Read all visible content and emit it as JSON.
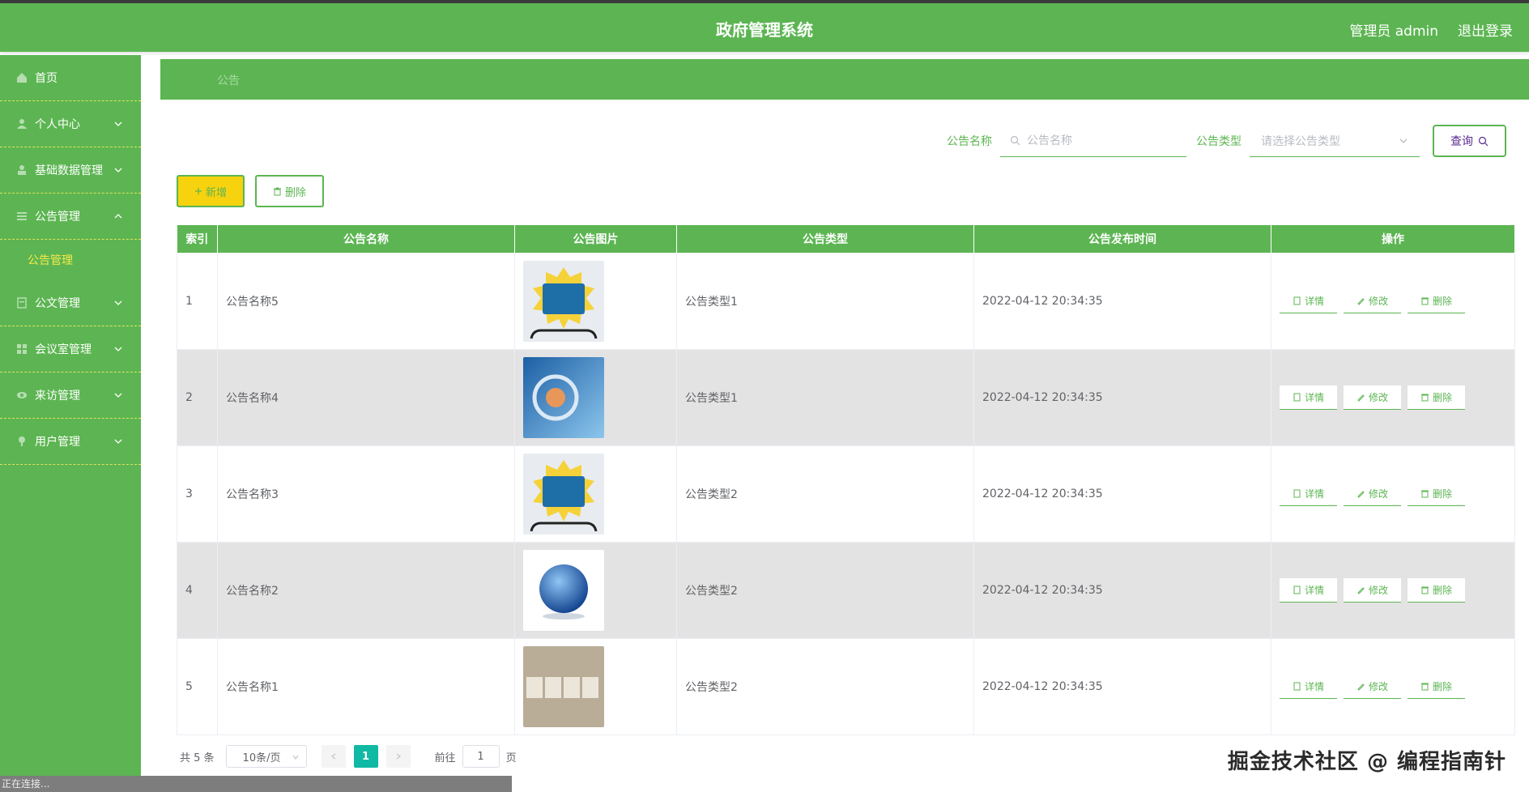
{
  "header": {
    "title": "政府管理系统",
    "user": "管理员 admin",
    "logout": "退出登录"
  },
  "sidebar": {
    "items": [
      {
        "label": "首页"
      },
      {
        "label": "个人中心"
      },
      {
        "label": "基础数据管理"
      },
      {
        "label": "公告管理"
      },
      {
        "label": "公文管理"
      },
      {
        "label": "会议室管理"
      },
      {
        "label": "来访管理"
      },
      {
        "label": "用户管理"
      }
    ],
    "sub_active": "公告管理"
  },
  "breadcrumb": "公告",
  "search": {
    "name_label": "公告名称",
    "name_placeholder": "公告名称",
    "type_label": "公告类型",
    "type_placeholder": "请选择公告类型",
    "query_label": "查询"
  },
  "actions": {
    "add": "新增",
    "delete": "删除"
  },
  "table": {
    "headers": [
      "索引",
      "公告名称",
      "公告图片",
      "公告类型",
      "公告发布时间",
      "操作"
    ],
    "rows": [
      {
        "index": "1",
        "name": "公告名称5",
        "image": "news-image-baodian",
        "type": "公告类型1",
        "time": "2022-04-12 20:34:35"
      },
      {
        "index": "2",
        "name": "公告名称4",
        "image": "news-image-blue",
        "type": "公告类型1",
        "time": "2022-04-12 20:34:35"
      },
      {
        "index": "3",
        "name": "公告名称3",
        "image": "news-image-baodian",
        "type": "公告类型2",
        "time": "2022-04-12 20:34:35"
      },
      {
        "index": "4",
        "name": "公告名称2",
        "image": "news-image-globe",
        "type": "公告类型2",
        "time": "2022-04-12 20:34:35"
      },
      {
        "index": "5",
        "name": "公告名称1",
        "image": "news-image-blocks",
        "type": "公告类型2",
        "time": "2022-04-12 20:34:35"
      }
    ],
    "op_detail": "详情",
    "op_edit": "修改",
    "op_delete": "删除"
  },
  "pagination": {
    "total": "共 5 条",
    "page_size": "10条/页",
    "current": "1",
    "goto_label": "前往",
    "goto_value": "1",
    "goto_suffix": "页"
  },
  "status": "正在连接...",
  "watermark": "掘金技术社区 @ 编程指南针",
  "colors": {
    "primary_green": "#5cb552",
    "accent_yellow": "#f7d20e",
    "page_active": "#10b9a3"
  }
}
